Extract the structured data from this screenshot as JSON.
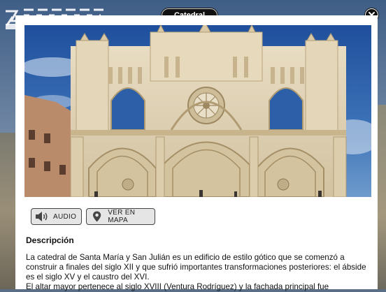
{
  "window": {
    "title": "Catedral"
  },
  "actions": {
    "audio_label": "AUDIO",
    "map_label": "VER EN MAPA"
  },
  "content": {
    "section_title": "Descripción",
    "paragraph_1": "La catedral de Santa María y San Julián es un edificio de estilo gótico que se comenzó a construir a finales del siglo XII y que sufrió importantes transformaciones posteriores: el ábside es el siglo XV y el caustro del XVI.",
    "paragraph_2": "El altar mayor pertenece al siglo XVIII (Ventura Rodríguez) y la fachada principal fue"
  },
  "icons": {
    "close": "close-icon",
    "audio": "speaker-icon",
    "map": "map-pin-icon"
  },
  "colors": {
    "title_bg": "#111111",
    "button_bg": "#e5e5e5",
    "panel_bg": "#ffffff"
  }
}
